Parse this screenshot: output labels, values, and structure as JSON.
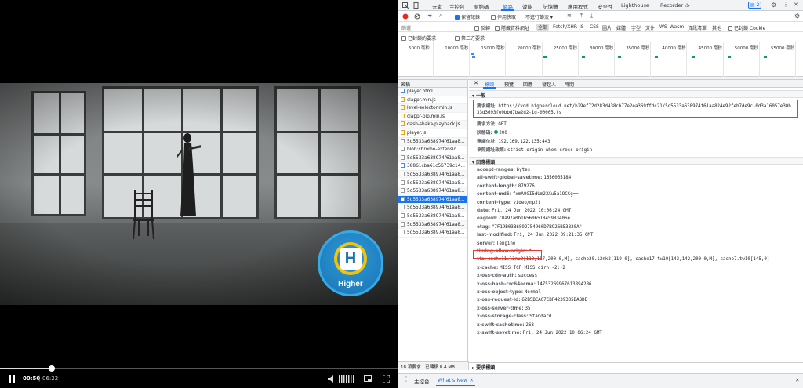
{
  "player": {
    "current_time": "00:50",
    "duration": "06:22",
    "progress": 0.131,
    "logo_text": "Higher",
    "logo_letter": "H"
  },
  "devtools": {
    "panel_tabs": [
      "元素",
      "主控台",
      "原始碼",
      "網路",
      "效能",
      "記憶體",
      "應用程式",
      "安全性",
      "Lighthouse",
      "Recorder ⚠"
    ],
    "active_panel": "網路",
    "issues_badge": "2",
    "toolbar1": {
      "preserve_log": "保留記錄",
      "disable_cache": "停用快取",
      "throttle": "不進行節流"
    },
    "toolbar2": {
      "filter_placeholder": "篩選",
      "invert": "反轉",
      "hide_data_urls": "隱藏資料網址",
      "all": "全部",
      "types": [
        "Fetch/XHR",
        "JS",
        "CSS",
        "圖片",
        "媒體",
        "字型",
        "文件",
        "WS",
        "Wasm",
        "資訊清單",
        "其他"
      ],
      "blocked_cookies": "已封鎖 Cookie"
    },
    "toolbar3": {
      "blocked_requests": "已封鎖的要求",
      "third_party": "第三方要求"
    },
    "timeline_ticks": [
      "5000 毫秒",
      "10000 毫秒",
      "15000 毫秒",
      "20000 毫秒",
      "25000 毫秒",
      "30000 毫秒",
      "35000 毫秒",
      "40000 毫秒",
      "45000 毫秒",
      "50000 毫秒",
      "55000 毫秒"
    ],
    "request_list": {
      "header": "名稱",
      "items": [
        {
          "name": "player.html",
          "type": "doc"
        },
        {
          "name": "clappr.min.js",
          "type": "js"
        },
        {
          "name": "level-selector.min.js",
          "type": "js"
        },
        {
          "name": "clappr-pip.min.js",
          "type": "js"
        },
        {
          "name": "dash-shaka-playback.js",
          "type": "js"
        },
        {
          "name": "player.js",
          "type": "js"
        },
        {
          "name": "5d5533a638974f61aa8...",
          "type": "file"
        },
        {
          "name": "blob:chrome-extensio...",
          "type": "file"
        },
        {
          "name": "5d5533a638974f61aa8...",
          "type": "file"
        },
        {
          "name": "38861cba61c56739c14...",
          "type": "doc"
        },
        {
          "name": "5d5533a638974f61aa8...",
          "type": "file"
        },
        {
          "name": "5d5533a638974f61aa8...",
          "type": "file"
        },
        {
          "name": "5d5533a638974f61aa8...",
          "type": "file"
        },
        {
          "name": "5d5533a638974f61aa8...",
          "type": "file"
        },
        {
          "name": "5d5533a638974f61aa8...",
          "type": "file"
        },
        {
          "name": "5d5533a638974f61aa8...",
          "type": "file"
        },
        {
          "name": "5d5533a638974f61aa8...",
          "type": "file"
        },
        {
          "name": "5d5533a638974f61aa8...",
          "type": "file"
        }
      ],
      "selected_index": 13
    },
    "status": "18 項要求  |  已轉移 8.4 MB",
    "detail_tabs": [
      "標頭",
      "預覽",
      "回應",
      "發起人",
      "時間"
    ],
    "active_detail_tab": "標頭",
    "general": {
      "title": "▾ 一般",
      "request_url_label": "要求網址:",
      "request_url": "https://vod.highercloud.net/b29ef72d283d438cb77e2ea369ffdc21/5d5533a638974f61aa824e92feb7de9c-0d3a16057e30b",
      "request_url_2": "33d3693fe0bbd7ba2d2-1d-00005.ts",
      "method_label": "要求方法:",
      "method": "GET",
      "status_label": "狀態碼:",
      "status": "200",
      "remote_label": "遠端位址:",
      "remote": "192.169.122.135:443",
      "policy_label": "參照網址政策:",
      "policy": "strict-origin-when-cross-origin"
    },
    "response_headers_title": "▾ 回應標頭",
    "response_headers": [
      {
        "k": "accept-ranges:",
        "v": "bytes"
      },
      {
        "k": "ali-swift-global-savetime:",
        "v": "1656065184"
      },
      {
        "k": "content-length:",
        "v": "879276"
      },
      {
        "k": "content-md5:",
        "v": "fxmA0GI5dUm23Xu5a1OCCg=="
      },
      {
        "k": "content-type:",
        "v": "video/mp2t"
      },
      {
        "k": "date:",
        "v": "Fri, 24 Jun 2022 10:06:24 GMT"
      },
      {
        "k": "eagleid:",
        "v": "c0a97a0b16560651845983406e"
      },
      {
        "k": "etag:",
        "v": "\"7F19B03B6892754960D7B926B53820A\""
      },
      {
        "k": "last-modified:",
        "v": "Fri, 24 Jun 2022 09:21:35 GMT"
      },
      {
        "k": "server:",
        "v": "Tengine"
      },
      {
        "k": "timing-allow-origin:",
        "v": "*"
      },
      {
        "k": "via:",
        "v": "cache11.l2nu2[118,117,200-0,M], cache20.l2nk2[119,0], cache17.tw10[143,142,200-0,M], cache7.tw10[145,0]"
      },
      {
        "k": "x-cache:",
        "v": "MISS TCP_MISS dirn:-2:-2"
      },
      {
        "k": "x-oss-cdn-auth:",
        "v": "success"
      },
      {
        "k": "x-oss-hash-crc64ecma:",
        "v": "14753269967613894286"
      },
      {
        "k": "x-oss-object-type:",
        "v": "Normal"
      },
      {
        "k": "x-oss-request-id:",
        "v": "62B5BCA07CBF4239335BA8DE"
      },
      {
        "k": "x-oss-server-time:",
        "v": "35"
      },
      {
        "k": "x-oss-storage-class:",
        "v": "Standard"
      },
      {
        "k": "x-swift-cachetime:",
        "v": "268"
      },
      {
        "k": "x-swift-savetime:",
        "v": "Fri, 24 Jun 2022 10:06:24 GMT"
      }
    ],
    "request_headers_title": "▸ 要求標頭",
    "drawer_tabs": [
      "主控台",
      "What's New ✕"
    ],
    "active_drawer": "What's New ✕",
    "colors": {
      "accent": "#1a73e8",
      "highlight": "#e53935",
      "status_ok": "#0f9d58"
    }
  }
}
